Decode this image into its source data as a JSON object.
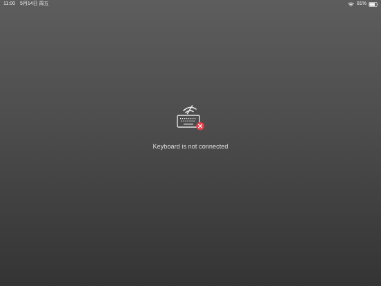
{
  "status_bar": {
    "time": "11:00",
    "date": "5月14日 周五",
    "battery_percent": "81%",
    "battery_level": 0.81,
    "wifi_icon": "wifi-icon",
    "battery_icon": "battery-icon"
  },
  "main": {
    "icon": "keyboard-disconnected-icon",
    "error_badge_color": "#e8404a",
    "message": "Keyboard is not connected"
  }
}
